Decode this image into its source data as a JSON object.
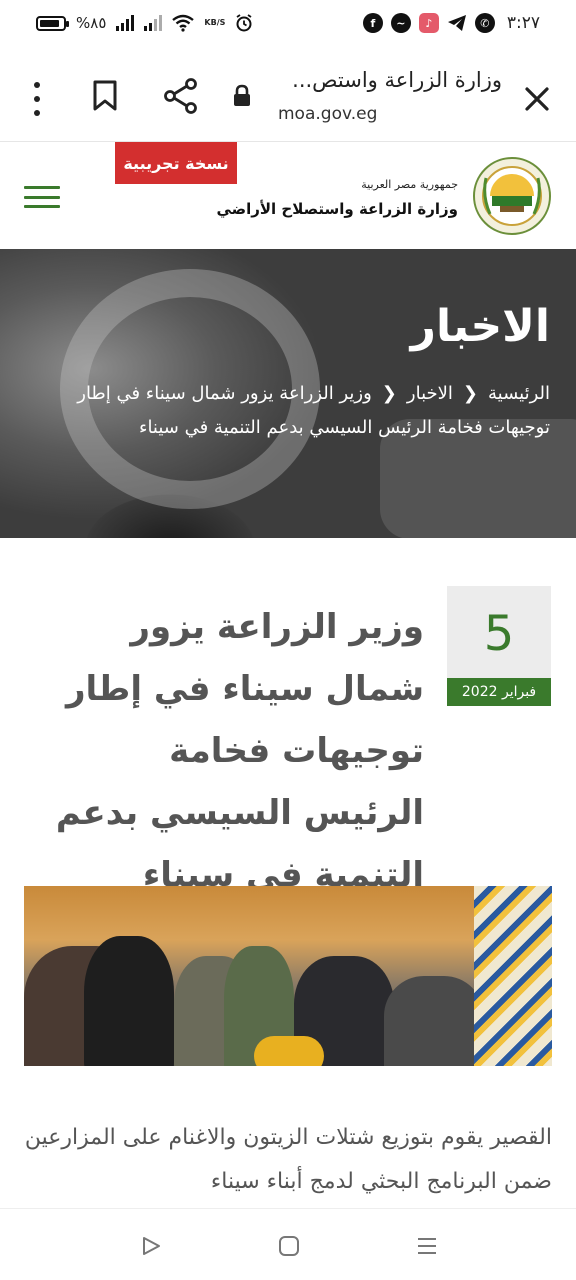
{
  "status_bar": {
    "time": "٣:٢٧",
    "battery_text": "%٨٥",
    "battery_level": 0.85,
    "speed_value": "KB/S",
    "app_icons": [
      "facebook-icon",
      "messenger-icon",
      "music-icon",
      "telegram-icon",
      "whatsapp-icon"
    ]
  },
  "browser": {
    "title": "وزارة الزراعة واستص...",
    "url": "moa.gov.eg"
  },
  "header": {
    "trial_badge": "نسخة تجريبية",
    "gov_line": "جمهورية مصر العربية",
    "ministry_name": "وزارة الزراعة واستصلاح الأراضي",
    "accent_color": "#3a7a2c",
    "badge_color": "#d32f2f"
  },
  "hero": {
    "title": "الاخبار",
    "breadcrumb": {
      "home": "الرئيسية",
      "section": "الاخبار",
      "current": "وزير الزراعة يزور شمال سيناء في إطار توجيهات فخامة الرئيس السيسي بدعم التنمية في سيناء"
    }
  },
  "article": {
    "date_day": "5",
    "date_month": "فبراير 2022",
    "title": "وزير الزراعة يزور شمال سيناء في إطار توجيهات فخامة الرئيس السيسي بدعم التنمية في سيناء",
    "body": "القصير يقوم بتوزيع شتلات الزيتون والاغنام على المزارعين ضمن البرنامج البحثي لدمج أبناء سيناء"
  },
  "nav": {
    "back": "back-icon",
    "home": "home-icon",
    "recent": "recent-apps-icon"
  }
}
